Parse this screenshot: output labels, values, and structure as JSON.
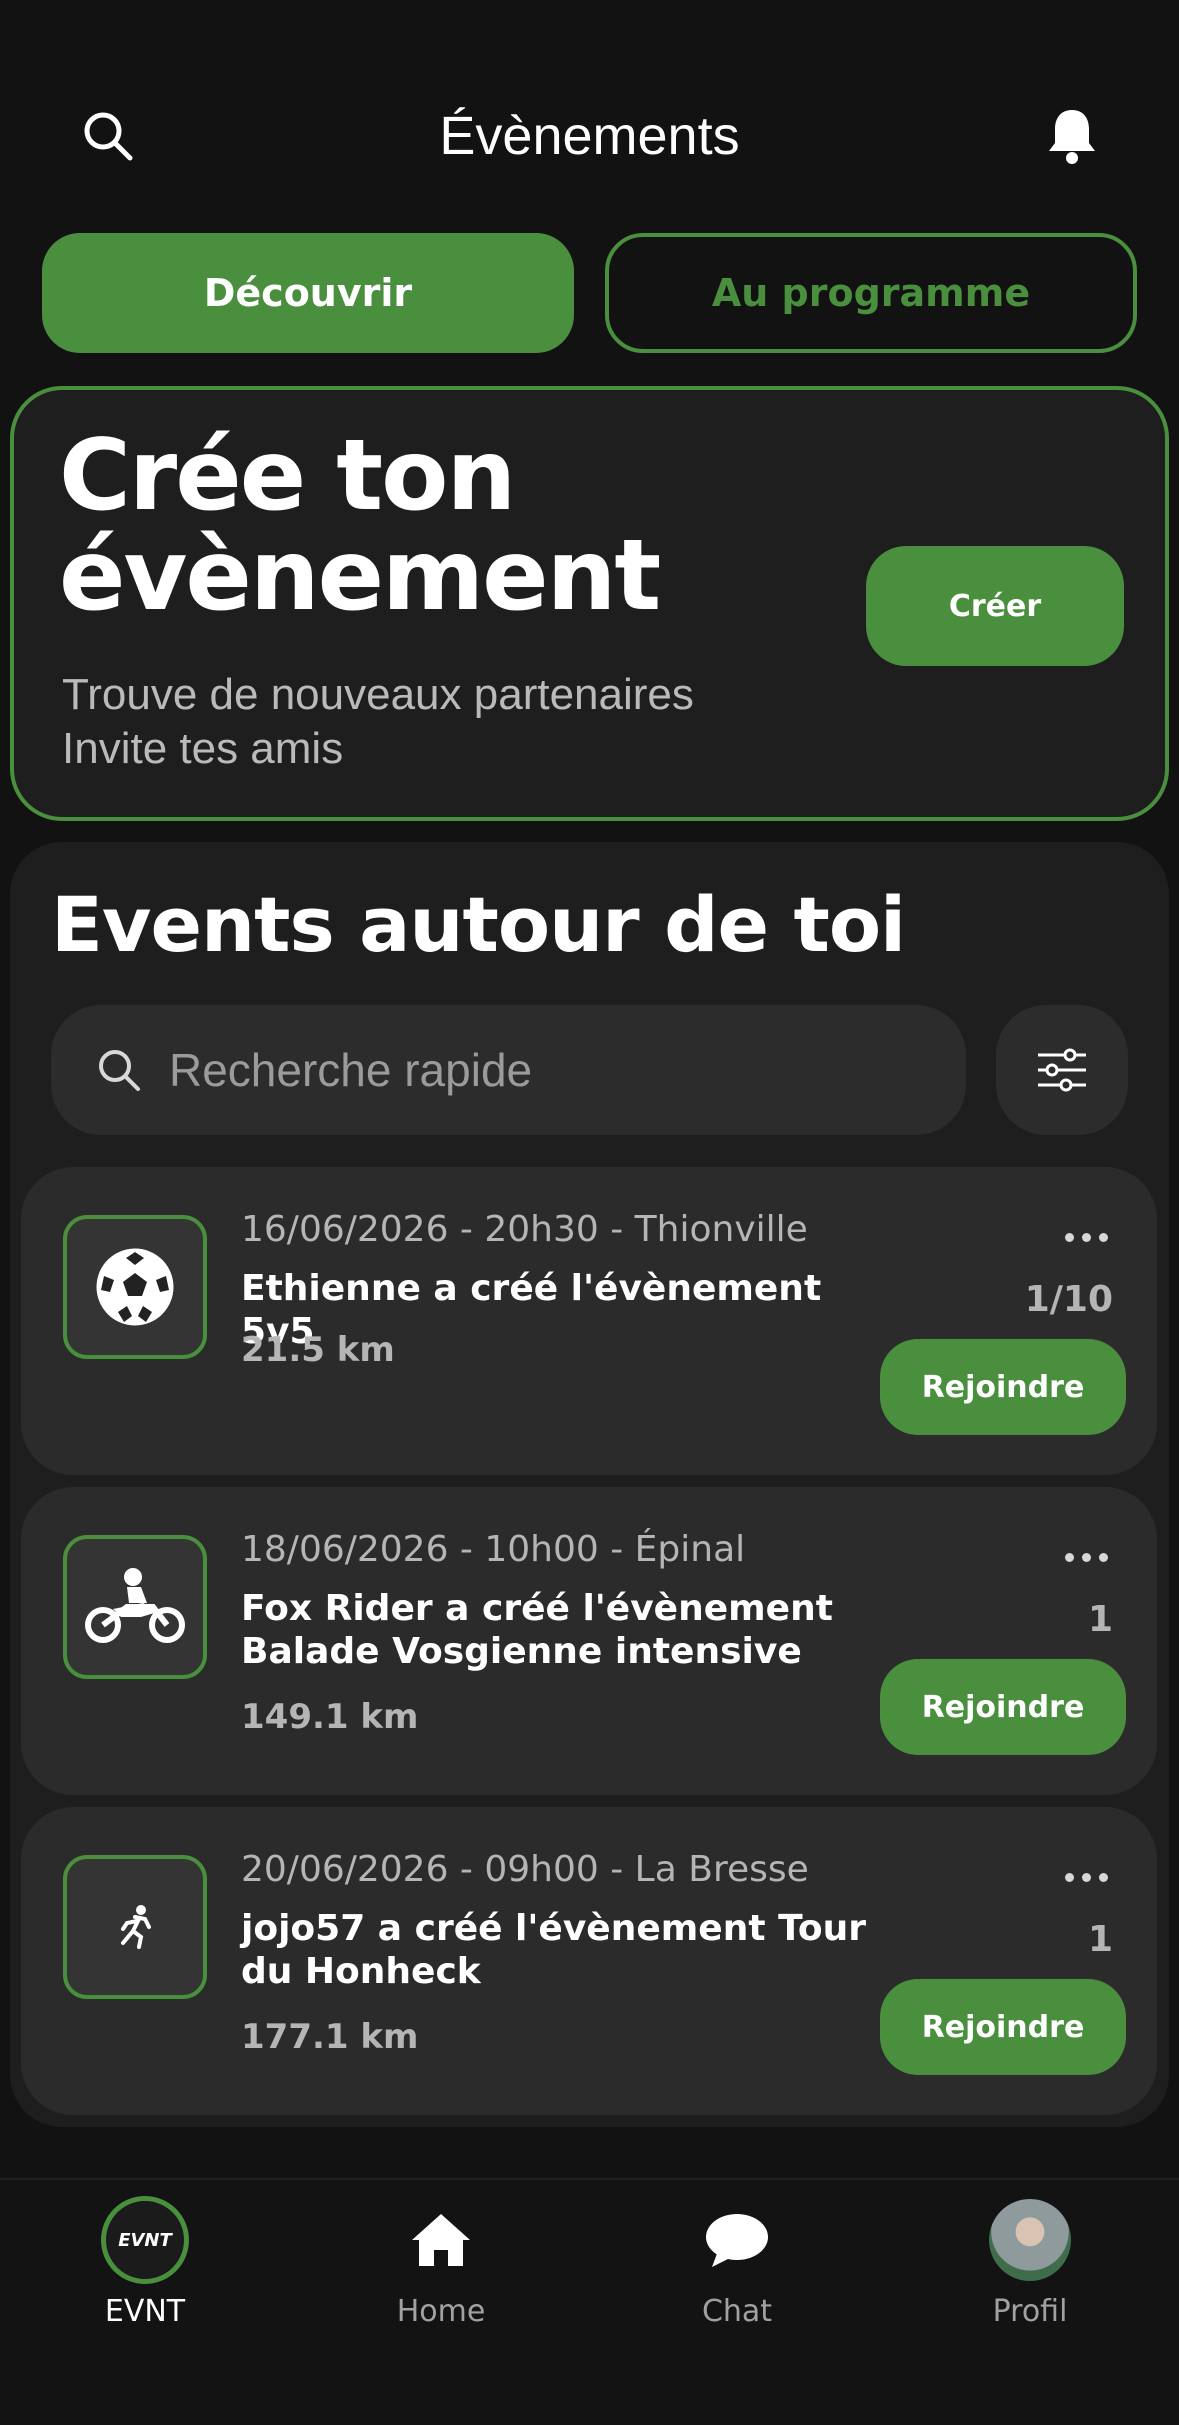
{
  "header": {
    "title": "Évènements"
  },
  "tabs": [
    {
      "label": "Découvrir",
      "active": true
    },
    {
      "label": "Au programme",
      "active": false
    }
  ],
  "hero": {
    "title": "Crée ton évènement",
    "subtitle_line1": "Trouve de nouveaux partenaires",
    "subtitle_line2": "Invite tes amis",
    "button": "Créer"
  },
  "events_section": {
    "title": "Events autour de toi",
    "search_placeholder": "Recherche rapide"
  },
  "events": [
    {
      "icon": "soccer-ball-icon",
      "date": "16/06/2026 - 20h30 - Thionville",
      "title": "Ethienne  a créé l'évènement 5v5",
      "distance": "21.5 km",
      "count": "1/10",
      "button": "Rejoindre"
    },
    {
      "icon": "motorcycle-icon",
      "date": "18/06/2026 - 10h00 - Épinal",
      "title": "Fox Rider a créé l'évènement Balade Vosgienne intensive",
      "distance": "149.1 km",
      "count": "1",
      "button": "Rejoindre"
    },
    {
      "icon": "runner-icon",
      "date": "20/06/2026 - 09h00 - La Bresse",
      "title": "jojo57 a créé l'évènement Tour du Honheck",
      "distance": "177.1 km",
      "count": "1",
      "button": "Rejoindre"
    }
  ],
  "bottom_nav": [
    {
      "label": "EVNT",
      "icon": "evnt-logo-icon",
      "active": true
    },
    {
      "label": "Home",
      "icon": "home-icon",
      "active": false
    },
    {
      "label": "Chat",
      "icon": "chat-bubble-icon",
      "active": false
    },
    {
      "label": "Profil",
      "icon": "avatar",
      "active": false
    }
  ],
  "colors": {
    "accent": "#4a8f3d",
    "background": "#111211",
    "card": "#2a2b2a"
  }
}
